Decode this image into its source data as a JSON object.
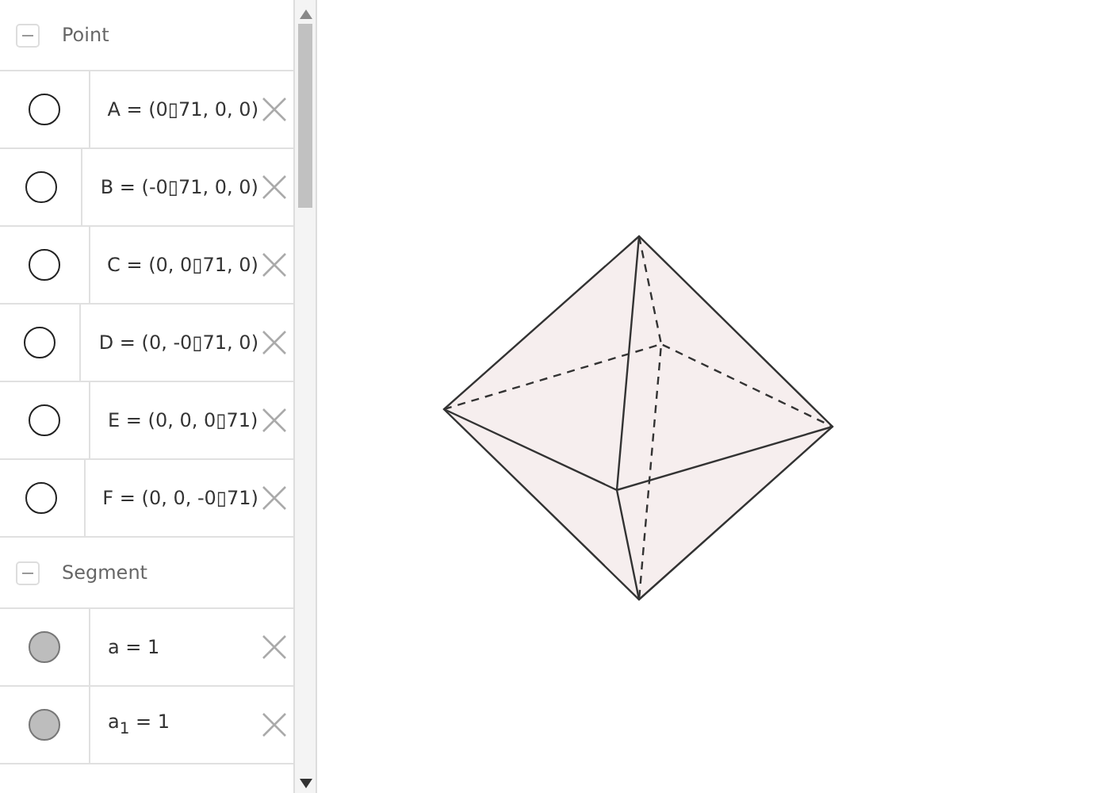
{
  "algebra_view": {
    "groups": [
      {
        "title": "Point",
        "expanded": true,
        "items": [
          {
            "definition": "A = (0▯71, 0, 0)",
            "shown": false
          },
          {
            "definition": "B = (-0▯71, 0, 0)",
            "shown": false
          },
          {
            "definition": "C = (0, 0▯71, 0)",
            "shown": false
          },
          {
            "definition": "D = (0, -0▯71, 0)",
            "shown": false
          },
          {
            "definition": "E = (0, 0, 0▯71)",
            "shown": false
          },
          {
            "definition": "F = (0, 0, -0▯71)",
            "shown": false
          }
        ]
      },
      {
        "title": "Segment",
        "expanded": true,
        "items": [
          {
            "definition": "a = 1",
            "shown": true
          },
          {
            "definition": "a$_{1}$ = 1",
            "shown": true
          }
        ]
      }
    ]
  }
}
